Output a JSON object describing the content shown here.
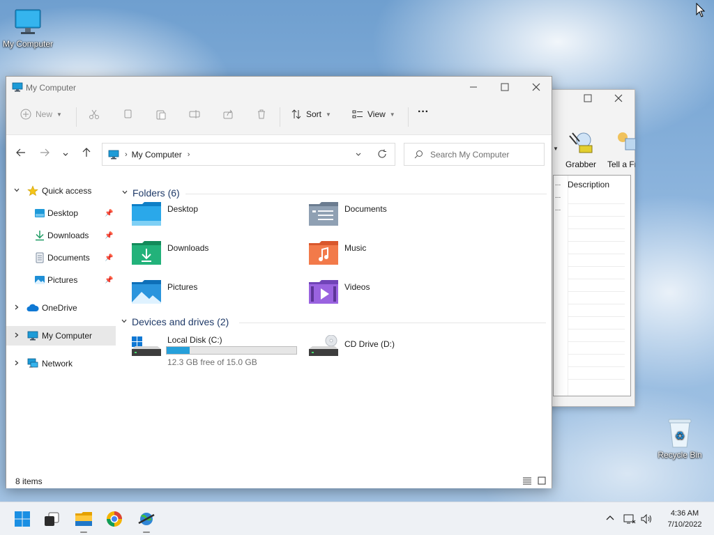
{
  "desktop": {
    "icons": [
      {
        "label": "My Computer"
      },
      {
        "label": "Recycle Bin"
      }
    ]
  },
  "bg_window": {
    "tools": [
      {
        "label": "Grabber"
      },
      {
        "label": "Tell a Fri"
      }
    ],
    "list_header": "Description"
  },
  "explorer": {
    "title": "My Computer",
    "toolbar": {
      "new_label": "New",
      "sort_label": "Sort",
      "view_label": "View",
      "more_label": "···"
    },
    "address": {
      "path": "My Computer"
    },
    "search": {
      "placeholder": "Search My Computer"
    },
    "sidebar": {
      "items": [
        {
          "label": "Quick access"
        },
        {
          "label": "Desktop"
        },
        {
          "label": "Downloads"
        },
        {
          "label": "Documents"
        },
        {
          "label": "Pictures"
        },
        {
          "label": "OneDrive"
        },
        {
          "label": "My Computer"
        },
        {
          "label": "Network"
        }
      ]
    },
    "folders_header": "Folders (6)",
    "folders": [
      {
        "label": "Desktop"
      },
      {
        "label": "Documents"
      },
      {
        "label": "Downloads"
      },
      {
        "label": "Music"
      },
      {
        "label": "Pictures"
      },
      {
        "label": "Videos"
      }
    ],
    "drives_header": "Devices and drives (2)",
    "drives": [
      {
        "label": "Local Disk (C:)",
        "free_text": "12.3 GB free of 15.0 GB",
        "used_fraction": 0.18
      },
      {
        "label": "CD Drive (D:)"
      }
    ],
    "status": {
      "item_count": "8 items"
    }
  },
  "taskbar": {
    "clock_time": "4:36 AM",
    "clock_date": "7/10/2022"
  },
  "colors": {
    "accent": "#26a0da",
    "section_header": "#1f3a68",
    "sidebar_active": "#e8e8e8"
  }
}
